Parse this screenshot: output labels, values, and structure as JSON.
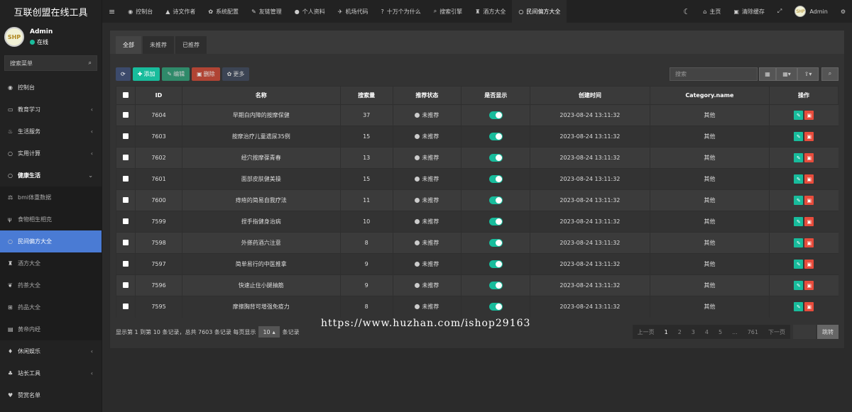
{
  "app": {
    "title": "互联创盟在线工具"
  },
  "user": {
    "name": "Admin",
    "status": "在线",
    "avatar_text": "SHP"
  },
  "sidebar": {
    "search_placeholder": "搜索菜单",
    "items": [
      {
        "label": "控制台",
        "icon": "dashboard-icon",
        "glyph": "◉",
        "type": "top",
        "chev": ""
      },
      {
        "label": "教育学习",
        "icon": "monitor-icon",
        "glyph": "▭",
        "type": "top",
        "chev": "‹"
      },
      {
        "label": "生活服务",
        "icon": "trophy-icon",
        "glyph": "♨",
        "type": "top",
        "chev": "‹"
      },
      {
        "label": "实用计算",
        "icon": "circle-icon",
        "glyph": "○",
        "type": "top",
        "chev": "‹"
      },
      {
        "label": "健康生活",
        "icon": "circle-icon",
        "glyph": "○",
        "type": "bold",
        "chev": "⌄"
      },
      {
        "label": "bmi体重数据",
        "icon": "scale-icon",
        "glyph": "⚖",
        "type": "sub",
        "chev": ""
      },
      {
        "label": "食物相生相克",
        "icon": "utensils-icon",
        "glyph": "ψ",
        "type": "sub",
        "chev": ""
      },
      {
        "label": "民间偏方大全",
        "icon": "circle-icon",
        "glyph": "○",
        "type": "active",
        "chev": ""
      },
      {
        "label": "酒方大全",
        "icon": "wine-icon",
        "glyph": "♜",
        "type": "sub",
        "chev": ""
      },
      {
        "label": "药茶大全",
        "icon": "leaf-icon",
        "glyph": "❦",
        "type": "sub",
        "chev": ""
      },
      {
        "label": "药品大全",
        "icon": "medkit-icon",
        "glyph": "⊞",
        "type": "sub",
        "chev": ""
      },
      {
        "label": "黄帝内经",
        "icon": "file-icon",
        "glyph": "▤",
        "type": "sub",
        "chev": ""
      },
      {
        "label": "休闲娱乐",
        "icon": "game-icon",
        "glyph": "♦",
        "type": "top",
        "chev": "‹"
      },
      {
        "label": "站长工具",
        "icon": "sitemap-icon",
        "glyph": "♣",
        "type": "top",
        "chev": "‹"
      },
      {
        "label": "赞赏名单",
        "icon": "heart-icon",
        "glyph": "♥",
        "type": "top",
        "chev": ""
      }
    ]
  },
  "topbar": {
    "tabs": [
      {
        "label": "控制台",
        "icon": "dashboard-icon",
        "glyph": "◉"
      },
      {
        "label": "诗文作者",
        "icon": "graduation-icon",
        "glyph": "▲"
      },
      {
        "label": "系统配置",
        "icon": "gear-icon",
        "glyph": "✿"
      },
      {
        "label": "友链管理",
        "icon": "link-icon",
        "glyph": "✎"
      },
      {
        "label": "个人资料",
        "icon": "user-icon",
        "glyph": "●"
      },
      {
        "label": "机场代码",
        "icon": "plane-icon",
        "glyph": "✈"
      },
      {
        "label": "十万个为什么",
        "icon": "question-icon",
        "glyph": "?"
      },
      {
        "label": "搜索引擎",
        "icon": "search-icon",
        "glyph": "⌕"
      },
      {
        "label": "酒方大全",
        "icon": "wine-icon",
        "glyph": "♜"
      },
      {
        "label": "民间偏方大全",
        "icon": "circle-icon",
        "glyph": "○"
      }
    ],
    "home": "主页",
    "clear_cache": "清除缓存",
    "admin": "Admin"
  },
  "content": {
    "filter_tabs": [
      "全部",
      "未推荐",
      "已推荐"
    ],
    "toolbar": {
      "add": "添加",
      "edit": "编辑",
      "delete": "删除",
      "more": "更多",
      "search_placeholder": "搜索"
    },
    "columns": [
      "ID",
      "名称",
      "搜索量",
      "推荐状态",
      "是否显示",
      "创建时间",
      "Category.name",
      "操作"
    ],
    "rows": [
      {
        "id": "7604",
        "name": "早期白内障的按摩保健",
        "count": "37",
        "status": "未推荐",
        "time": "2023-08-24 13:11:32",
        "category": "其他"
      },
      {
        "id": "7603",
        "name": "按摩治疗儿童遗尿35例",
        "count": "15",
        "status": "未推荐",
        "time": "2023-08-24 13:11:32",
        "category": "其他"
      },
      {
        "id": "7602",
        "name": "经穴按摩葆青春",
        "count": "13",
        "status": "未推荐",
        "time": "2023-08-24 13:11:32",
        "category": "其他"
      },
      {
        "id": "7601",
        "name": "面部皮肤健美操",
        "count": "15",
        "status": "未推荐",
        "time": "2023-08-24 13:11:32",
        "category": "其他"
      },
      {
        "id": "7600",
        "name": "痔疮的简易自我疗法",
        "count": "11",
        "status": "未推荐",
        "time": "2023-08-24 13:11:32",
        "category": "其他"
      },
      {
        "id": "7599",
        "name": "捏手指健身治病",
        "count": "10",
        "status": "未推荐",
        "time": "2023-08-24 13:11:32",
        "category": "其他"
      },
      {
        "id": "7598",
        "name": "外搽药酒六注意",
        "count": "8",
        "status": "未推荐",
        "time": "2023-08-24 13:11:32",
        "category": "其他"
      },
      {
        "id": "7597",
        "name": "简单易行的中医推拿",
        "count": "9",
        "status": "未推荐",
        "time": "2023-08-24 13:11:32",
        "category": "其他"
      },
      {
        "id": "7596",
        "name": "快速止住小腿抽筋",
        "count": "9",
        "status": "未推荐",
        "time": "2023-08-24 13:11:32",
        "category": "其他"
      },
      {
        "id": "7595",
        "name": "摩擦胸背可增强免疫力",
        "count": "8",
        "status": "未推荐",
        "time": "2023-08-24 13:11:32",
        "category": "其他"
      }
    ],
    "footer": {
      "info": "显示第 1 到第 10 条记录，总共 7603 条记录 每页显示",
      "page_size": "10",
      "suffix": "条记录"
    },
    "pagination": {
      "prev": "上一页",
      "pages": [
        "1",
        "2",
        "3",
        "4",
        "5",
        "...",
        "761"
      ],
      "next": "下一页",
      "jump": "跳转"
    }
  },
  "watermark": "https://www.huzhan.com/ishop29163"
}
